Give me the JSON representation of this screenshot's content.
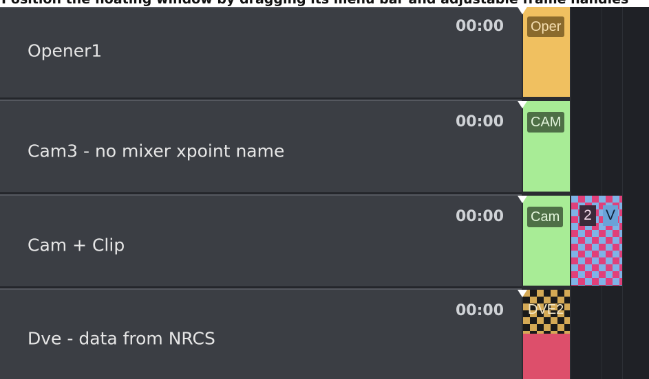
{
  "tooltip": {
    "text": "Position the floating window by dragging its menu bar and adjustable frame handles"
  },
  "segments": [
    {
      "name": "Opener1",
      "duration": "00:00",
      "piece_label": "Oper",
      "color": "#f0c060"
    },
    {
      "name": "Cam3 - no mixer xpoint name",
      "duration": "00:00",
      "piece_label": "CAM",
      "color": "#a8ec96"
    },
    {
      "name": "Cam + Clip",
      "duration": "00:00",
      "piece_label": "Cam",
      "color": "#a8ec96",
      "clip_badge": "2",
      "clip_label": "V"
    },
    {
      "name": "Dve - data from NRCS",
      "duration": "00:00",
      "piece_label": "DVE2",
      "color": "#dd4f6b"
    }
  ],
  "colors": {
    "segment_bg": "#3b3e44",
    "label_bg": "#5b6b4a",
    "camera": "#a8ec96",
    "opener": "#f0c060",
    "dve": "#dd4f6b"
  }
}
